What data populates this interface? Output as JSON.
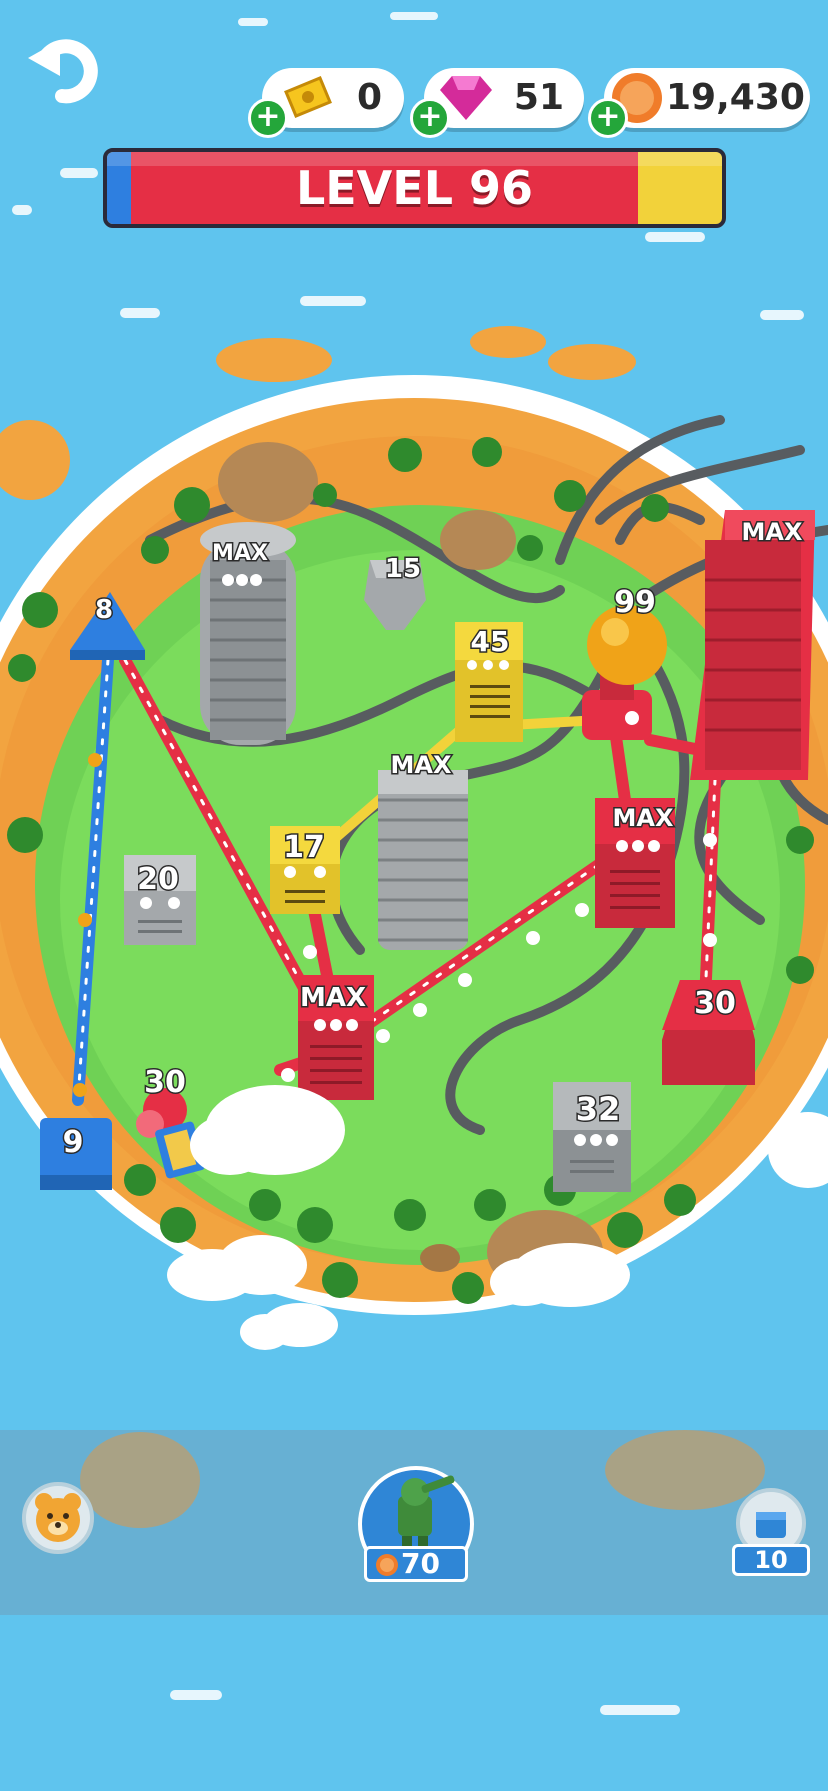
{
  "hud": {
    "tickets": "0",
    "gems": "51",
    "coins": "19,430",
    "level_label": "LEVEL 96",
    "icons": {
      "back": "undo-arrow-icon",
      "tickets": "ticket-icon",
      "gems": "gem-icon",
      "coins": "coin-icon",
      "plus": "plus-icon"
    }
  },
  "map": {
    "buildings": [
      {
        "id": "blue-tri-8",
        "label": "8",
        "team": "blue"
      },
      {
        "id": "blue-base-9",
        "label": "9",
        "team": "blue"
      },
      {
        "id": "gray-tower-max",
        "label": "MAX",
        "team": "neutral"
      },
      {
        "id": "gray-small-15",
        "label": "15",
        "team": "neutral"
      },
      {
        "id": "yellow-45",
        "label": "45",
        "team": "yellow"
      },
      {
        "id": "orange-ball-99",
        "label": "99",
        "team": "red"
      },
      {
        "id": "red-tower-max",
        "label": "MAX",
        "team": "red"
      },
      {
        "id": "gray-mid-max",
        "label": "MAX",
        "team": "neutral"
      },
      {
        "id": "yellow-17",
        "label": "17",
        "team": "yellow"
      },
      {
        "id": "gray-20",
        "label": "20",
        "team": "neutral"
      },
      {
        "id": "red-mid-max",
        "label": "MAX",
        "team": "red"
      },
      {
        "id": "red-base-max",
        "label": "MAX",
        "team": "red"
      },
      {
        "id": "red-30-right",
        "label": "30",
        "team": "red"
      },
      {
        "id": "gray-32",
        "label": "32",
        "team": "neutral"
      },
      {
        "id": "red-unit-30",
        "label": "30",
        "team": "red"
      }
    ]
  },
  "bottom": {
    "bear_icon": "bear-icon",
    "unit_icon": "zombie-unit-icon",
    "unit_price": "70",
    "coin_icon": "coin-icon",
    "box_icon": "shield-box-icon",
    "box_count": "10"
  },
  "colors": {
    "red_team": "#e52f45",
    "blue_team": "#2e7fe0",
    "yellow_team": "#f2d23a",
    "neutral": "#a4a8ab"
  }
}
